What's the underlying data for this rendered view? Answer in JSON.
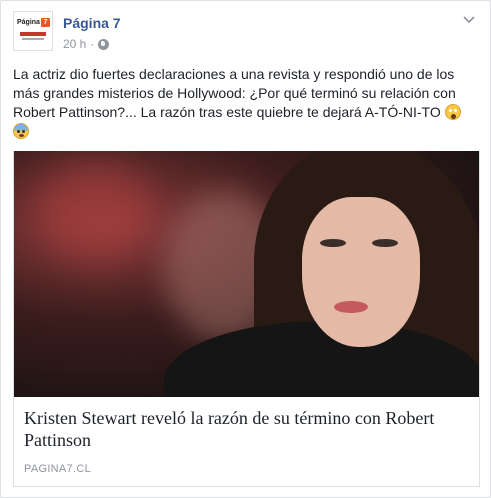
{
  "post": {
    "page_name": "Página 7",
    "timestamp": "20 h",
    "separator": "·",
    "privacy_icon": "globe-icon",
    "menu_icon": "chevron-down-icon",
    "text": "La actriz dio fuertes declaraciones a una revista y respondió uno de los más grandes misterios de Hollywood: ¿Por qué terminó su relación con Robert Pattinson?... La razón tras este quiebre te dejará A-TÓ-NI-TO",
    "emojis": [
      "face-screaming-in-fear-emoji",
      "fearful-face-emoji"
    ]
  },
  "avatar": {
    "logo_text": "Página",
    "logo_number": "7"
  },
  "link_preview": {
    "title": "Kristen Stewart reveló la razón de su término con Robert Pattinson",
    "domain": "PAGINA7.CL"
  },
  "colors": {
    "page_name": "#365899",
    "meta": "#90949c",
    "logo_accent": "#e8582a"
  }
}
